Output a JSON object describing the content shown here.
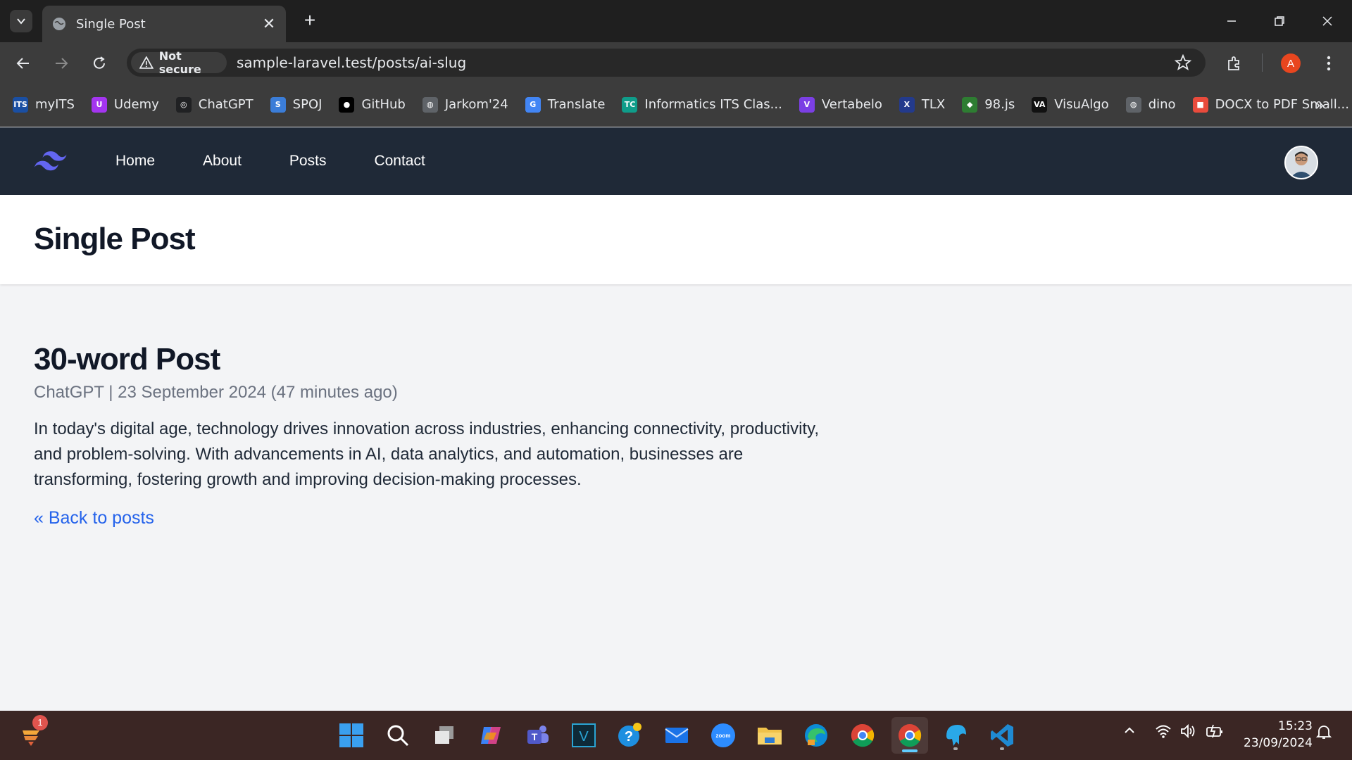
{
  "browser": {
    "tab_title": "Single Post",
    "security_label": "Not secure",
    "url": "sample-laravel.test/posts/ai-slug",
    "profile_initial": "A",
    "bookmarks": [
      {
        "label": "myITS",
        "icon": "its-icon",
        "color": "#1a4fa3",
        "glyph": "ITS"
      },
      {
        "label": "Udemy",
        "icon": "udemy-icon",
        "color": "#a435f0",
        "glyph": "U"
      },
      {
        "label": "ChatGPT",
        "icon": "chatgpt-icon",
        "color": "#202123",
        "glyph": "◎"
      },
      {
        "label": "SPOJ",
        "icon": "spoj-icon",
        "color": "#3b7dd8",
        "glyph": "S"
      },
      {
        "label": "GitHub",
        "icon": "github-icon",
        "color": "#000000",
        "glyph": "●"
      },
      {
        "label": "Jarkom'24",
        "icon": "globe-icon",
        "color": "#5f6368",
        "glyph": "◍"
      },
      {
        "label": "Translate",
        "icon": "translate-icon",
        "color": "#4285f4",
        "glyph": "G"
      },
      {
        "label": "Informatics ITS Clas...",
        "icon": "tc-icon",
        "color": "#0f9d8a",
        "glyph": "TC"
      },
      {
        "label": "Vertabelo",
        "icon": "vertabelo-icon",
        "color": "#7b3fe4",
        "glyph": "V"
      },
      {
        "label": "TLX",
        "icon": "tlx-icon",
        "color": "#233a8c",
        "glyph": "X"
      },
      {
        "label": "98.js",
        "icon": "windows98-icon",
        "color": "#2e7d32",
        "glyph": "◆"
      },
      {
        "label": "VisuAlgo",
        "icon": "visualgo-icon",
        "color": "#111111",
        "glyph": "VA"
      },
      {
        "label": "dino",
        "icon": "globe-icon",
        "color": "#5f6368",
        "glyph": "◍"
      },
      {
        "label": "DOCX to PDF Small...",
        "icon": "smallpdf-icon",
        "color": "#e94b3c",
        "glyph": "■"
      }
    ]
  },
  "nav": {
    "links": [
      "Home",
      "About",
      "Posts",
      "Contact"
    ]
  },
  "header": {
    "title": "Single Post"
  },
  "post": {
    "title": "30-word Post",
    "meta": "ChatGPT | 23 September 2024 (47 minutes ago)",
    "body": "In today's digital age, technology drives innovation across industries, enhancing connectivity, productivity, and problem-solving. With advancements in AI, data analytics, and automation, businesses are transforming, fostering growth and improving decision-making processes.",
    "back_link": "« Back to posts"
  },
  "taskbar": {
    "notification_count": "1",
    "time": "15:23",
    "date": "23/09/2024"
  }
}
